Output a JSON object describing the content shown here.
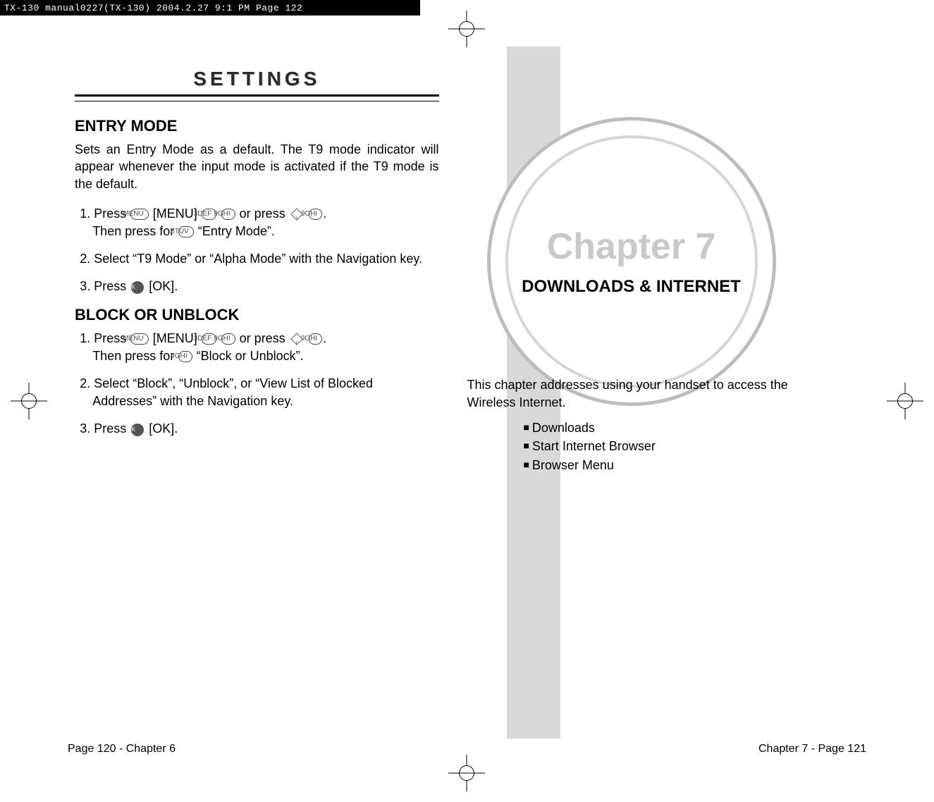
{
  "header_strip": "TX-130 manual0227(TX-130)  2004.2.27  9:1 PM  Page 122",
  "left_page": {
    "title": "SETTINGS",
    "sections": [
      {
        "heading": "ENTRY MODE",
        "intro": "Sets an Entry Mode as a default. The T9 mode indicator will appear whenever the input mode is activated if the T9 mode is the default.",
        "steps": [
          {
            "num": "1.",
            "pre": "Press",
            "after1": "[MENU]",
            "or": "or press",
            "dot": ".",
            "line2_pre": "Then press for",
            "line2_quote": "“Entry Mode”."
          },
          {
            "simple": "2. Select “T9 Mode” or “Alpha Mode” with the Navigation key."
          },
          {
            "num": "3.",
            "pre": "Press",
            "after1": "[OK]."
          }
        ]
      },
      {
        "heading": "BLOCK OR UNBLOCK",
        "steps": [
          {
            "num": "1.",
            "pre": "Press",
            "after1": "[MENU]",
            "or": "or press",
            "dot": ".",
            "line2_pre": "Then press for",
            "line2_quote": "“Block or Unblock”."
          },
          {
            "simple": "2. Select “Block”, “Unblock”, or “View List of Blocked Addresses” with the Navigation key."
          },
          {
            "num": "3.",
            "pre": "Press",
            "after1": "[OK]."
          }
        ]
      }
    ],
    "footer": "Page 120 - Chapter 6"
  },
  "right_page": {
    "chapter_title": "Chapter 7",
    "chapter_subtitle": "DOWNLOADS & INTERNET",
    "intro": "This chapter addresses using your handset to access the Wireless Internet.",
    "bullets": [
      "Downloads",
      "Start Internet Browser",
      "Browser Menu"
    ],
    "footer": "Chapter 7 - Page 121"
  },
  "icons": {
    "menu_key": "MENU",
    "key_3def": "3DEF",
    "key_9ghi": "9GHI",
    "key_8tuv": "8TUV",
    "ok_circle": "OK",
    "nav_diamond": "◆"
  }
}
